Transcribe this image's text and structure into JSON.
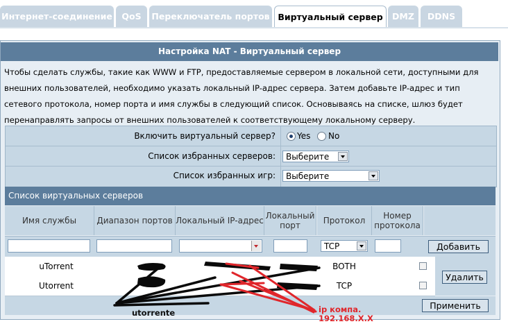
{
  "tabs": [
    {
      "label": "Интернет-соединение",
      "active": false
    },
    {
      "label": "QoS",
      "active": false
    },
    {
      "label": "Переключатель портов",
      "active": false
    },
    {
      "label": "Виртуальный сервер",
      "active": true
    },
    {
      "label": "DMZ",
      "active": false
    },
    {
      "label": "DDNS",
      "active": false
    }
  ],
  "panel": {
    "title": "Настройка NAT - Виртуальный сервер",
    "description": "Чтобы сделать службы, такие как WWW и FTP, предоставляемые сервером в локальной сети, доступными для внешних пользователей, необходимо указать локальный IP-адрес сервера. Затем добавьте IP-адрес и тип сетевого протокола, номер порта и имя службы в следующий список. Основываясь на списке, шлюз будет перенаправлять запросы от внешних пользователей к соответствующему локальному серверу."
  },
  "form": {
    "enable_label": "Включить виртуальный сервер?",
    "yes_label": "Yes",
    "no_label": "No",
    "enabled": "Yes",
    "servers_label": "Список избранных серверов:",
    "servers_value": "Выберите",
    "games_label": "Список избранных игр:",
    "games_value": "Выберите"
  },
  "vs_table": {
    "header": "Список виртуальных серверов",
    "columns": [
      "Имя службы",
      "Диапазон портов",
      "Локальный IP-адрес",
      "Локальный порт",
      "Протокол",
      "Номер протокола"
    ],
    "protocol_default": "TCP",
    "add_button": "Добавить",
    "delete_button": "Удалить",
    "apply_button": "Применить",
    "rows": [
      {
        "name": "uTorrent",
        "protocol": "BOTH"
      },
      {
        "name": "Utorrent",
        "protocol": "TCP"
      }
    ]
  },
  "annotations": {
    "label1": "utorrente",
    "label2_line1": "ip компа.",
    "label2_line2": "192.168.X.X"
  },
  "colors": {
    "header_bg": "#5c7d9c",
    "band_bg": "#c6d7e4",
    "scribble_red": "#e0262b"
  }
}
